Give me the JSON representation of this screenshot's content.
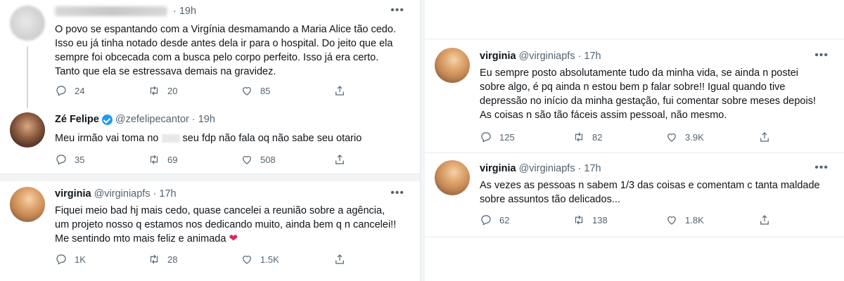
{
  "left": {
    "tweets": [
      {
        "name": "",
        "handle": "",
        "time": "19h",
        "text": "O povo se espantando com a Virgínia desmamando a Maria Alice tão cedo. Isso eu já tinha notado desde antes dela ir para o hospital. Do jeito que ela sempre foi obcecada com a busca pelo corpo perfeito. Isso já era certo. Tanto que ela se estressava demais na gravidez.",
        "replies": "24",
        "retweets": "20",
        "likes": "85"
      },
      {
        "name": "Zé Felipe",
        "handle": "@zefelipecantor",
        "time": "19h",
        "text_before": "Meu irmão vai toma no",
        "text_after": "seu fdp não fala oq não sabe seu otario",
        "replies": "35",
        "retweets": "69",
        "likes": "508"
      },
      {
        "name": "virginia",
        "handle": "@virginiapfs",
        "time": "17h",
        "text": "Fiquei meio bad hj mais cedo, quase cancelei a reunião sobre a agência, um projeto nosso q estamos nos dedicando muito, ainda bem q n cancelei!! Me sentindo mto mais feliz e animada",
        "emoji": "❤",
        "replies": "1K",
        "retweets": "28",
        "likes": "1.5K"
      }
    ]
  },
  "right": {
    "tweets": [
      {
        "name": "virginia",
        "handle": "@virginiapfs",
        "time": "17h",
        "text": "Eu sempre posto absolutamente tudo da minha vida, se ainda n postei sobre algo, é pq ainda n estou bem p falar sobre!! Igual quando tive depressão no início da minha gestação, fui comentar sobre meses depois! As coisas n são tão fáceis assim pessoal, não mesmo.",
        "replies": "125",
        "retweets": "82",
        "likes": "3.9K"
      },
      {
        "name": "virginia",
        "handle": "@virginiapfs",
        "time": "17h",
        "text": "As vezes as pessoas n sabem 1/3 das coisas e comentam c tanta maldade sobre assuntos tão delicados...",
        "replies": "62",
        "retweets": "138",
        "likes": "1.8K"
      }
    ]
  },
  "ui": {
    "dot": "·",
    "more": "•••"
  },
  "icons": [
    "reply-icon",
    "retweet-icon",
    "like-icon",
    "share-icon",
    "verified-badge-icon",
    "more-icon"
  ]
}
